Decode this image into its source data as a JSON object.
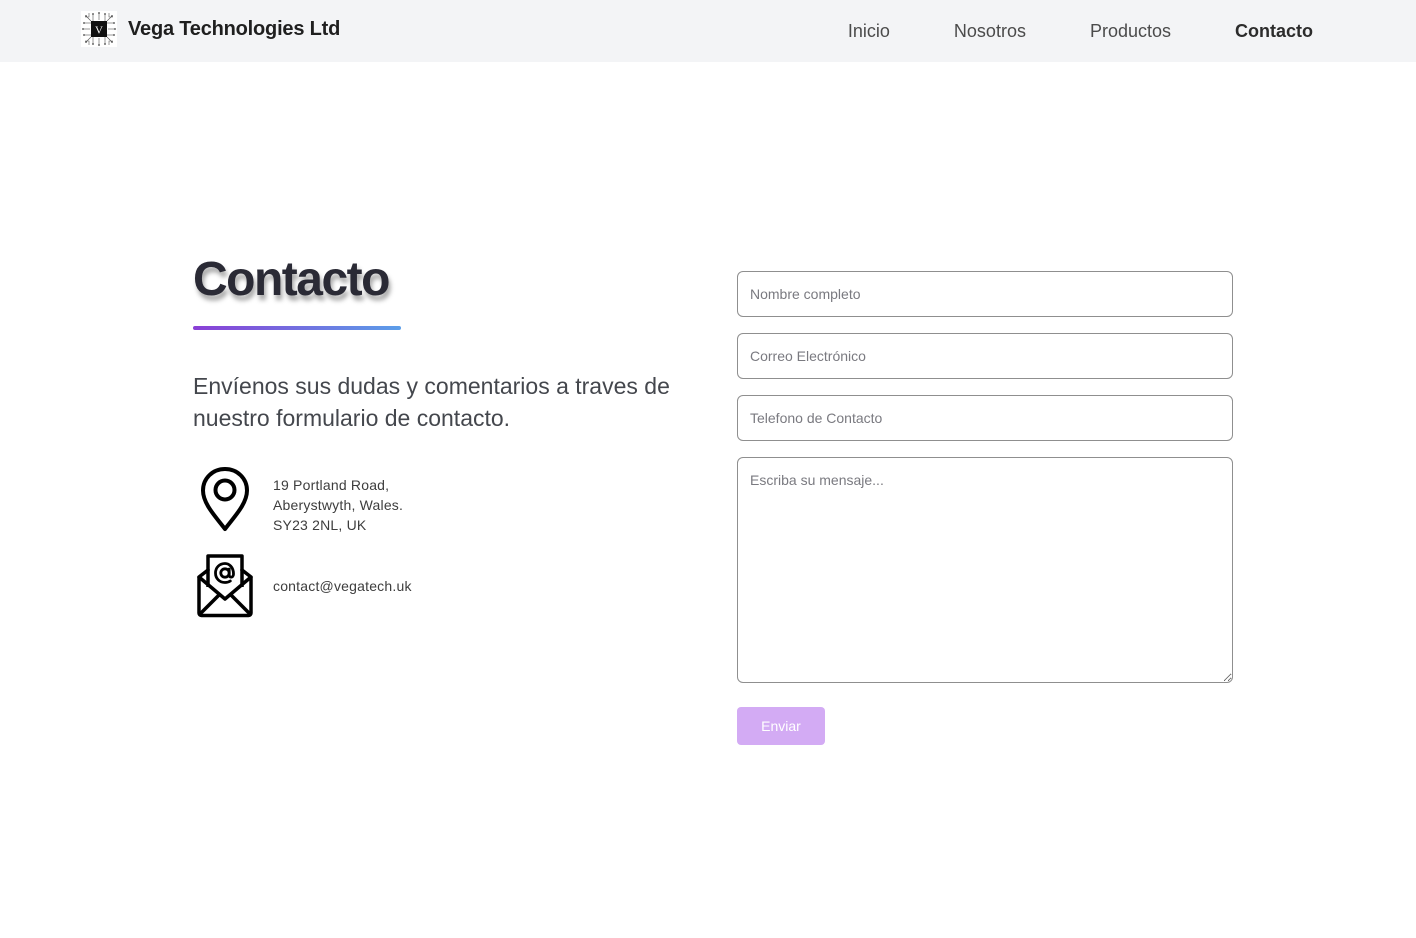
{
  "header": {
    "brand_name": "Vega Technologies Ltd",
    "logo_letter": "V",
    "nav": [
      {
        "label": "Inicio",
        "active": false
      },
      {
        "label": "Nosotros",
        "active": false
      },
      {
        "label": "Productos",
        "active": false
      },
      {
        "label": "Contacto",
        "active": true
      }
    ]
  },
  "contact": {
    "title": "Contacto",
    "intro": "Envíenos sus dudas y comentarios a traves de nuestro formulario de contacto.",
    "address_lines": [
      "19 Portland Road,",
      "Aberystwyth, Wales.",
      "SY23 2NL, UK"
    ],
    "email": "contact@vegatech.uk"
  },
  "form": {
    "name_placeholder": "Nombre completo",
    "email_placeholder": "Correo Electrónico",
    "phone_placeholder": "Telefono de Contacto",
    "message_placeholder": "Escriba su mensaje...",
    "submit_label": "Enviar"
  },
  "colors": {
    "header_bg": "#f3f4f6",
    "accent_gradient_start": "#8a3fd6",
    "accent_gradient_end": "#5b9ee9",
    "submit_bg": "#d3abf4"
  },
  "icons": {
    "logo": "circuit-logo-icon",
    "address": "map-pin-icon",
    "email": "envelope-at-icon"
  }
}
